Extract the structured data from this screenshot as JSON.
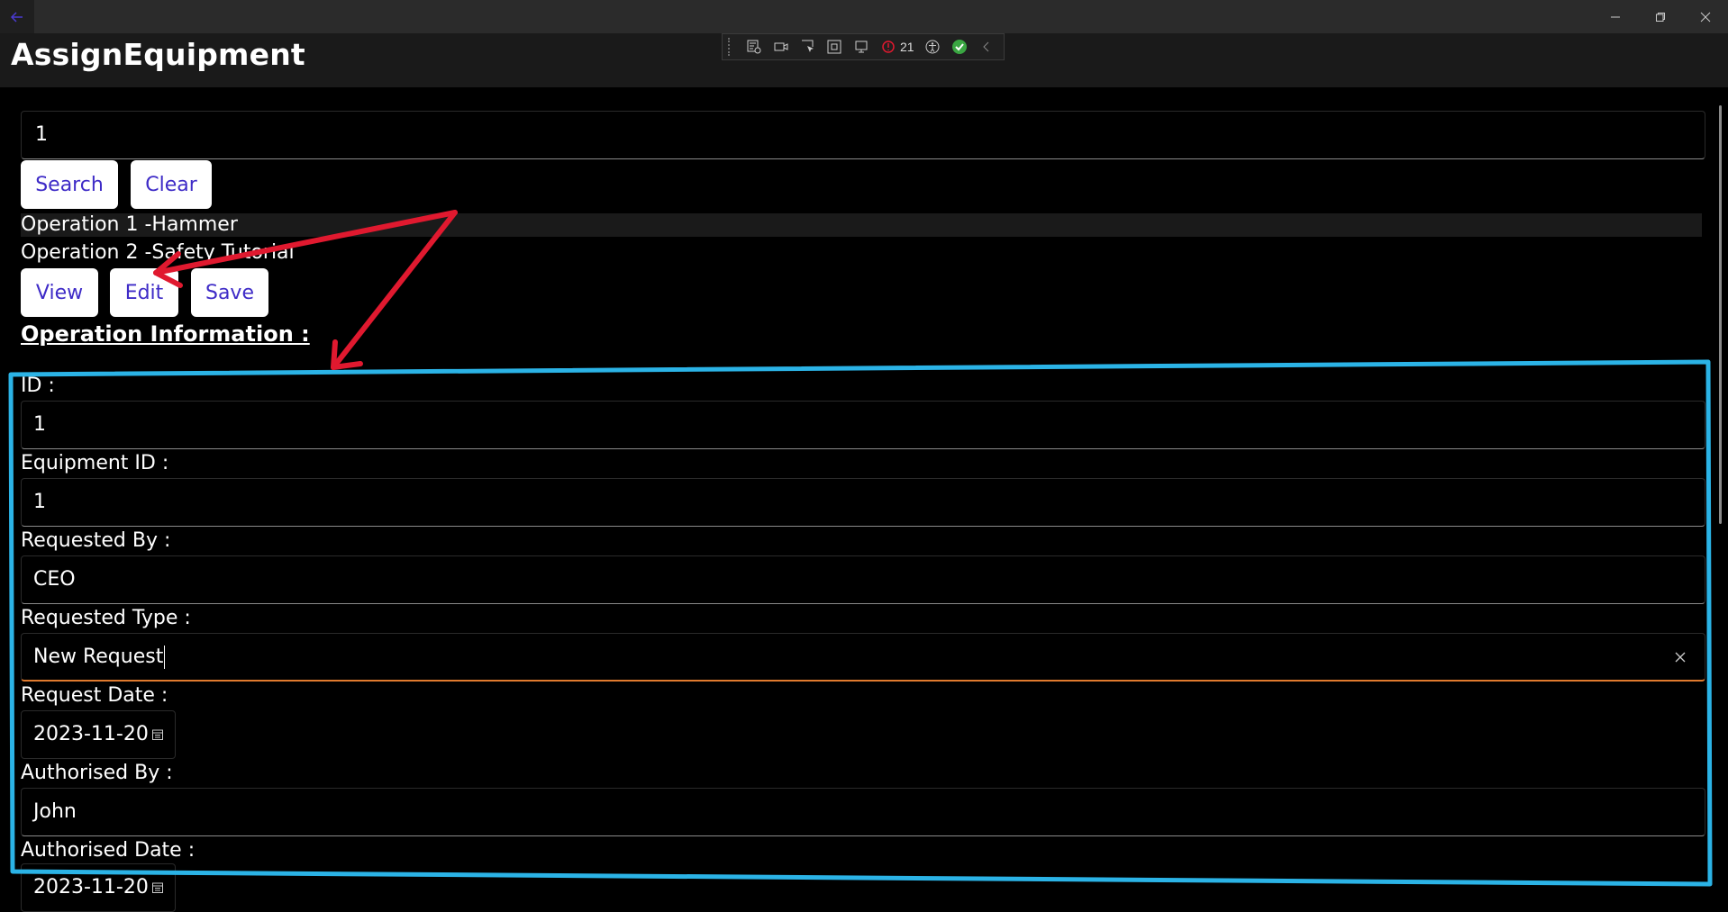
{
  "app": {
    "title": "AssignEquipment"
  },
  "debug_toolbar": {
    "error_count": "21"
  },
  "search": {
    "value": "1",
    "search_label": "Search",
    "clear_label": "Clear"
  },
  "operations": [
    {
      "label": "Operation 1 -Hammer"
    },
    {
      "label": "Operation 2 -Safety Tutorial"
    }
  ],
  "actions": {
    "view_label": "View",
    "edit_label": "Edit",
    "save_label": "Save"
  },
  "section": {
    "title": "Operation Information :"
  },
  "fields": {
    "id": {
      "label": "ID :",
      "value": "1"
    },
    "equipment_id": {
      "label": "Equipment ID :",
      "value": "1"
    },
    "requested_by": {
      "label": "Requested By :",
      "value": "CEO"
    },
    "requested_type": {
      "label": "Requested Type :",
      "value": "New Request"
    },
    "request_date": {
      "label": "Request Date :",
      "value": "2023-11-20"
    },
    "authorised_by": {
      "label": "Authorised By :",
      "value": "John"
    },
    "authorised_date": {
      "label": "Authorised Date :",
      "value": "2023-11-20"
    }
  },
  "annotations": {
    "arrow_color": "#e0192f",
    "box_color": "#2bb3e6"
  },
  "colors": {
    "button_text": "#3e2bc7",
    "focus_underline": "#e07a2e"
  }
}
